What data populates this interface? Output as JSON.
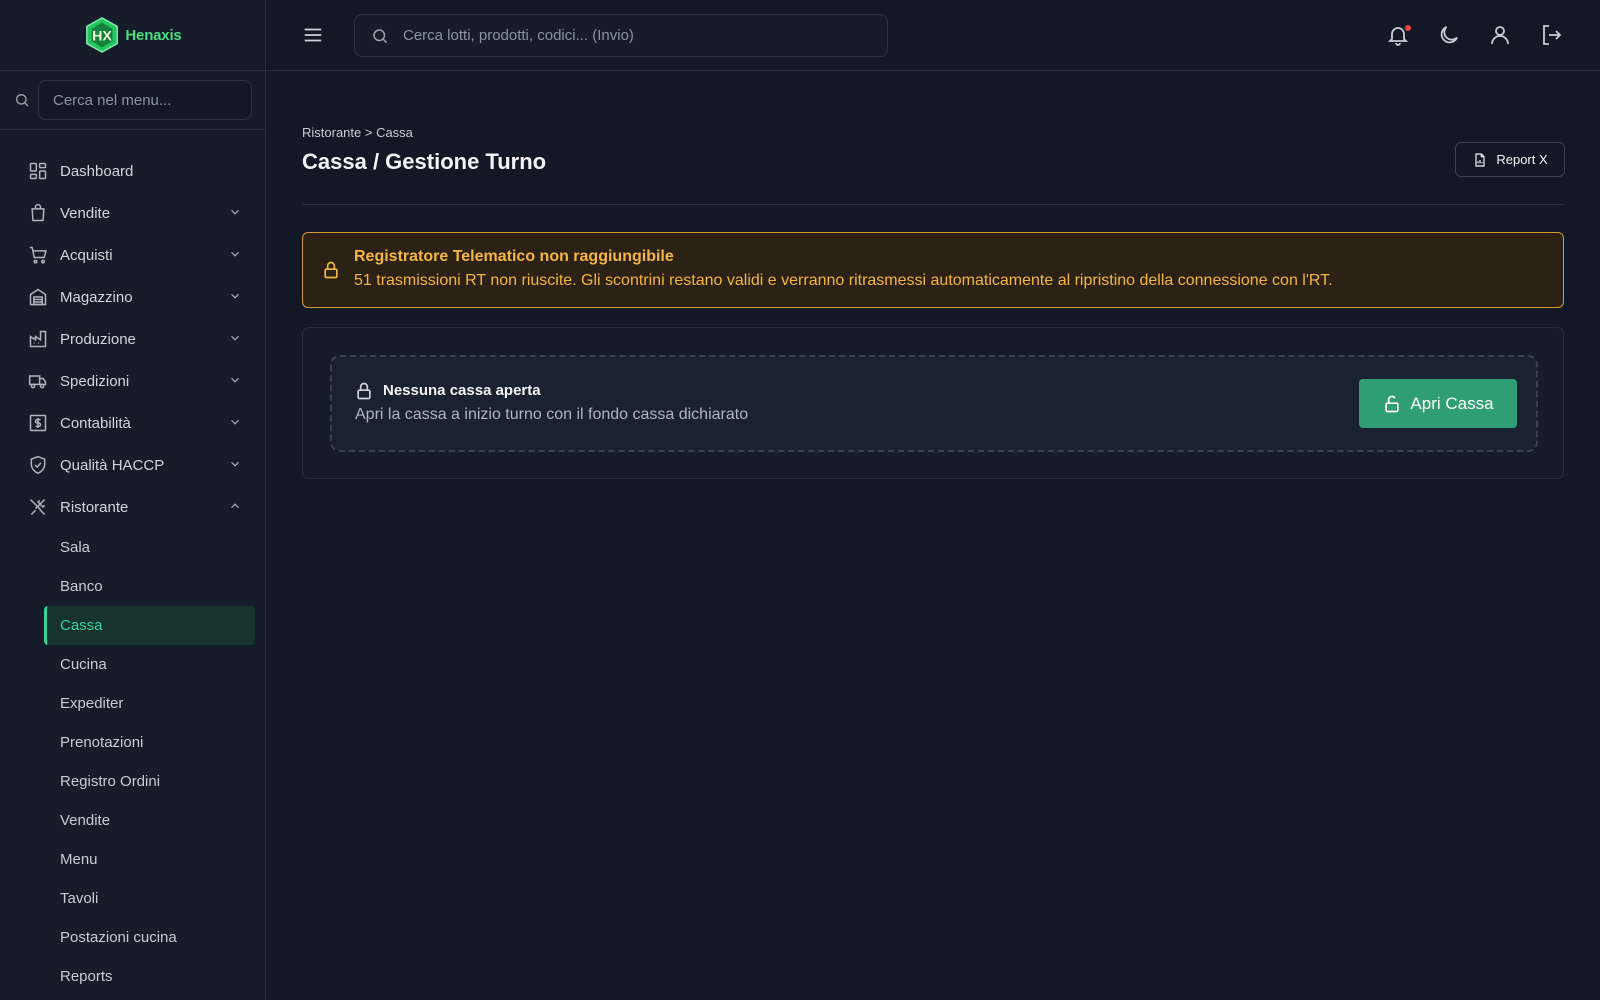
{
  "brand": {
    "name": "Henaxis",
    "logo_letters": "HX"
  },
  "sidebar": {
    "search_placeholder": "Cerca nel menu...",
    "items": [
      {
        "label": "Dashboard",
        "icon": "dashboard-icon"
      },
      {
        "label": "Vendite",
        "icon": "bag-icon"
      },
      {
        "label": "Acquisti",
        "icon": "cart-icon"
      },
      {
        "label": "Magazzino",
        "icon": "warehouse-icon"
      },
      {
        "label": "Produzione",
        "icon": "factory-icon"
      },
      {
        "label": "Spedizioni",
        "icon": "truck-icon"
      },
      {
        "label": "Contabilità",
        "icon": "dollar-icon"
      },
      {
        "label": "Qualità HACCP",
        "icon": "shield-check-icon"
      },
      {
        "label": "Ristorante",
        "icon": "utensils-icon"
      }
    ],
    "sub_items": [
      {
        "label": "Sala"
      },
      {
        "label": "Banco"
      },
      {
        "label": "Cassa"
      },
      {
        "label": "Cucina"
      },
      {
        "label": "Expediter"
      },
      {
        "label": "Prenotazioni"
      },
      {
        "label": "Registro Ordini"
      },
      {
        "label": "Vendite"
      },
      {
        "label": "Menu"
      },
      {
        "label": "Tavoli"
      },
      {
        "label": "Postazioni cucina"
      },
      {
        "label": "Reports"
      }
    ]
  },
  "topbar": {
    "search_placeholder": "Cerca lotti, prodotti, codici... (Invio)"
  },
  "main": {
    "breadcrumb": "Ristorante > Cassa",
    "title": "Cassa / Gestione Turno",
    "report_button": "Report X",
    "alert": {
      "title": "Registratore Telematico non raggiungibile",
      "text": "51 trasmissioni RT non riuscite. Gli scontrini restano validi e verranno ritrasmessi automaticamente al ripristino della connessione con l'RT."
    },
    "empty_state": {
      "title": "Nessuna cassa aperta",
      "subtitle": "Apri la cassa a inizio turno con il fondo cassa dichiarato",
      "button": "Apri Cassa"
    }
  },
  "colors": {
    "accent": "#2f9e74",
    "active_text": "#34d399",
    "warning": "#f5b544",
    "background": "#121826",
    "sidebar": "#161c29"
  }
}
